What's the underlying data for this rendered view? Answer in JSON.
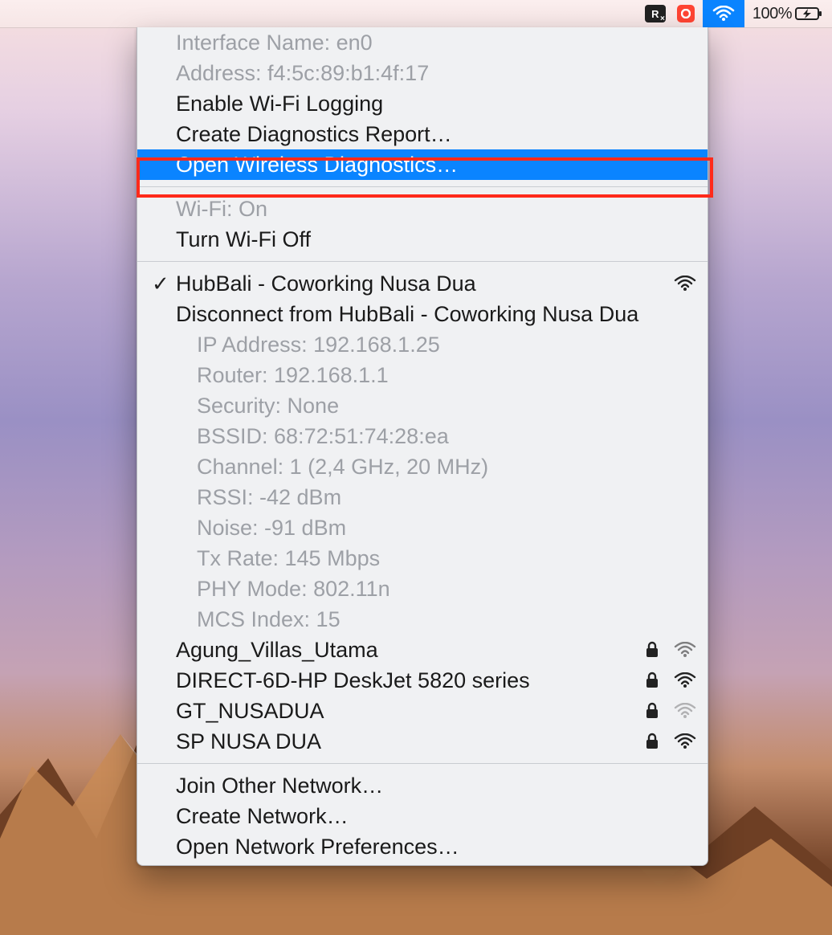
{
  "menubar": {
    "battery_percent": "100%"
  },
  "section_diag": {
    "interface_name": "Interface Name: en0",
    "address": "Address: f4:5c:89:b1:4f:17",
    "enable_logging": "Enable Wi-Fi Logging",
    "create_report": "Create Diagnostics Report…",
    "open_diag": "Open Wireless Diagnostics…"
  },
  "section_wifi_state": {
    "status": "Wi-Fi: On",
    "turn_off": "Turn Wi-Fi Off"
  },
  "connected": {
    "ssid": "HubBali - Coworking Nusa Dua",
    "disconnect": "Disconnect from HubBali - Coworking Nusa Dua",
    "details": {
      "ip": "IP Address: 192.168.1.25",
      "router": "Router: 192.168.1.1",
      "security": "Security: None",
      "bssid": "BSSID: 68:72:51:74:28:ea",
      "channel": "Channel: 1 (2,4 GHz, 20 MHz)",
      "rssi": "RSSI: -42 dBm",
      "noise": "Noise: -91 dBm",
      "txrate": "Tx Rate: 145 Mbps",
      "phy": "PHY Mode: 802.11n",
      "mcs": "MCS Index: 15"
    }
  },
  "networks": [
    {
      "name": "Agung_Villas_Utama",
      "locked": true,
      "signal": "low"
    },
    {
      "name": "DIRECT-6D-HP DeskJet 5820 series",
      "locked": true,
      "signal": "high"
    },
    {
      "name": "GT_NUSADUA",
      "locked": true,
      "signal": "vlow"
    },
    {
      "name": "SP NUSA DUA",
      "locked": true,
      "signal": "high"
    }
  ],
  "footer": {
    "join_other": "Join Other Network…",
    "create_net": "Create Network…",
    "open_prefs": "Open Network Preferences…"
  }
}
